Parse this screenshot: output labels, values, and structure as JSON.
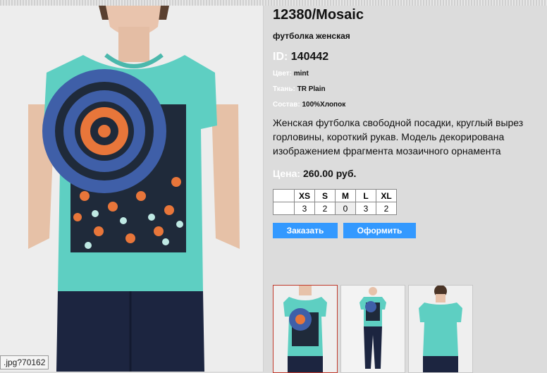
{
  "product": {
    "title": "12380/Mosaic",
    "subtitle": "футболка женская",
    "id_label": "ID:",
    "id_value": "140442",
    "color_label": "Цвет:",
    "color_value": "mint",
    "fabric_label": "Ткань:",
    "fabric_value": "TR Plain",
    "composition_label": "Состав:",
    "composition_value": "100%Хлопок",
    "description": "Женская футболка свободной посадки, круглый вырез горловины, короткий рукав. Модель декорирована изображением фрагмента мозаичного орнамента",
    "price_label": "Цена:",
    "price_value": "260.00 руб."
  },
  "sizes": {
    "headers": [
      "XS",
      "S",
      "M",
      "L",
      "XL"
    ],
    "stock": [
      "3",
      "2",
      "0",
      "3",
      "2"
    ]
  },
  "buttons": {
    "order": "Заказать",
    "checkout": "Оформить"
  },
  "status_tip": ".jpg?70162",
  "colors": {
    "accent_button": "#3399ff",
    "shirt": "#5ecfc2",
    "active_thumb_border": "#c0392b"
  },
  "icons": [
    "front-photo",
    "full-body-photo",
    "back-photo"
  ]
}
